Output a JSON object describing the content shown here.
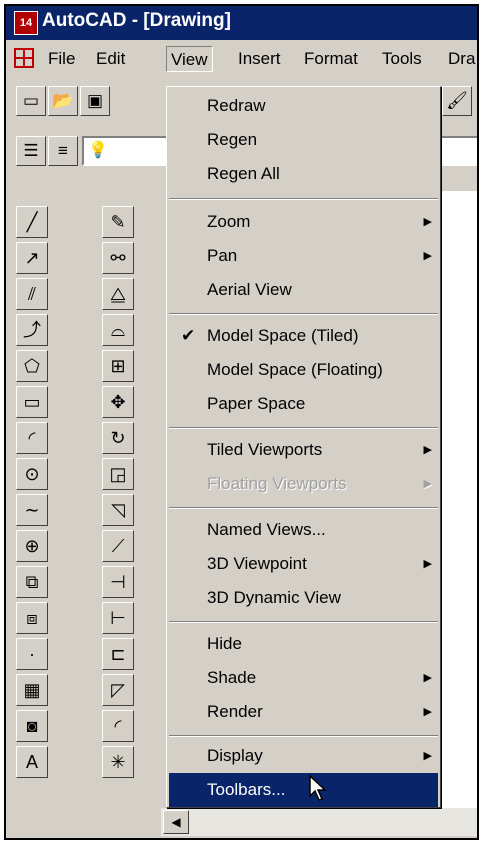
{
  "window": {
    "app_icon_text": "14",
    "title": "AutoCAD - [Drawing]"
  },
  "menubar": {
    "items": [
      {
        "label": "File"
      },
      {
        "label": "Edit"
      },
      {
        "label": "View"
      },
      {
        "label": "Insert"
      },
      {
        "label": "Format"
      },
      {
        "label": "Tools"
      },
      {
        "label": "Dra"
      }
    ],
    "open_item": "View"
  },
  "view_menu": {
    "groups": [
      [
        {
          "label": "Redraw"
        },
        {
          "label": "Regen"
        },
        {
          "label": "Regen All"
        }
      ],
      [
        {
          "label": "Zoom",
          "submenu": true
        },
        {
          "label": "Pan",
          "submenu": true
        },
        {
          "label": "Aerial View"
        }
      ],
      [
        {
          "label": "Model Space (Tiled)",
          "checked": true
        },
        {
          "label": "Model Space (Floating)"
        },
        {
          "label": "Paper Space"
        }
      ],
      [
        {
          "label": "Tiled Viewports",
          "submenu": true
        },
        {
          "label": "Floating Viewports",
          "submenu": true,
          "disabled": true
        }
      ],
      [
        {
          "label": "Named Views..."
        },
        {
          "label": "3D Viewpoint",
          "submenu": true
        },
        {
          "label": "3D Dynamic View"
        }
      ],
      [
        {
          "label": "Hide"
        },
        {
          "label": "Shade",
          "submenu": true
        },
        {
          "label": "Render",
          "submenu": true
        }
      ],
      [
        {
          "label": "Display",
          "submenu": true
        },
        {
          "label": "Toolbars...",
          "highlighted": true
        }
      ]
    ]
  },
  "colors": {
    "title_bar": "#0a246a",
    "face": "#d4d0c8",
    "highlight": "#0a246a"
  }
}
